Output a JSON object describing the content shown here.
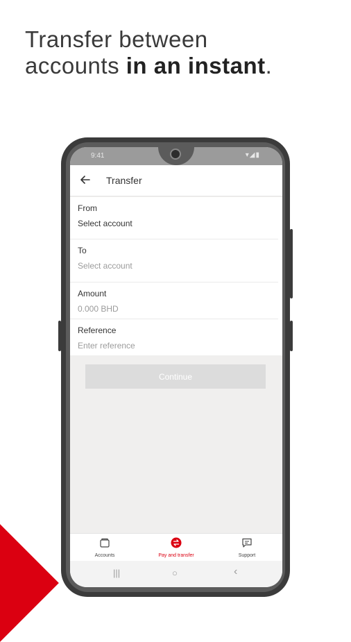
{
  "headline": {
    "line1": "Transfer between",
    "line2_plain": "accounts ",
    "line2_bold": "in an instant",
    "line2_end": "."
  },
  "status_bar": {
    "time": "9:41",
    "icons": "▾◢▮"
  },
  "app_bar": {
    "title": "Transfer"
  },
  "form": {
    "from": {
      "label": "From",
      "value": "Select account"
    },
    "to": {
      "label": "To",
      "placeholder": "Select account"
    },
    "amount": {
      "label": "Amount",
      "placeholder": "0.000 BHD"
    },
    "reference": {
      "label": "Reference",
      "placeholder": "Enter reference"
    }
  },
  "continue_label": "Continue",
  "bottom_nav": [
    {
      "label": "Accounts",
      "icon": "wallet-icon",
      "active": false
    },
    {
      "label": "Pay and transfer",
      "icon": "transfer-icon",
      "active": true
    },
    {
      "label": "Support",
      "icon": "chat-icon",
      "active": false
    }
  ],
  "system_nav": {
    "recents": "|||",
    "home": "○",
    "back": "‹"
  },
  "colors": {
    "brand_red": "#db0011",
    "disabled_button": "#dcdcdc",
    "frame": "#3b3b3b"
  }
}
